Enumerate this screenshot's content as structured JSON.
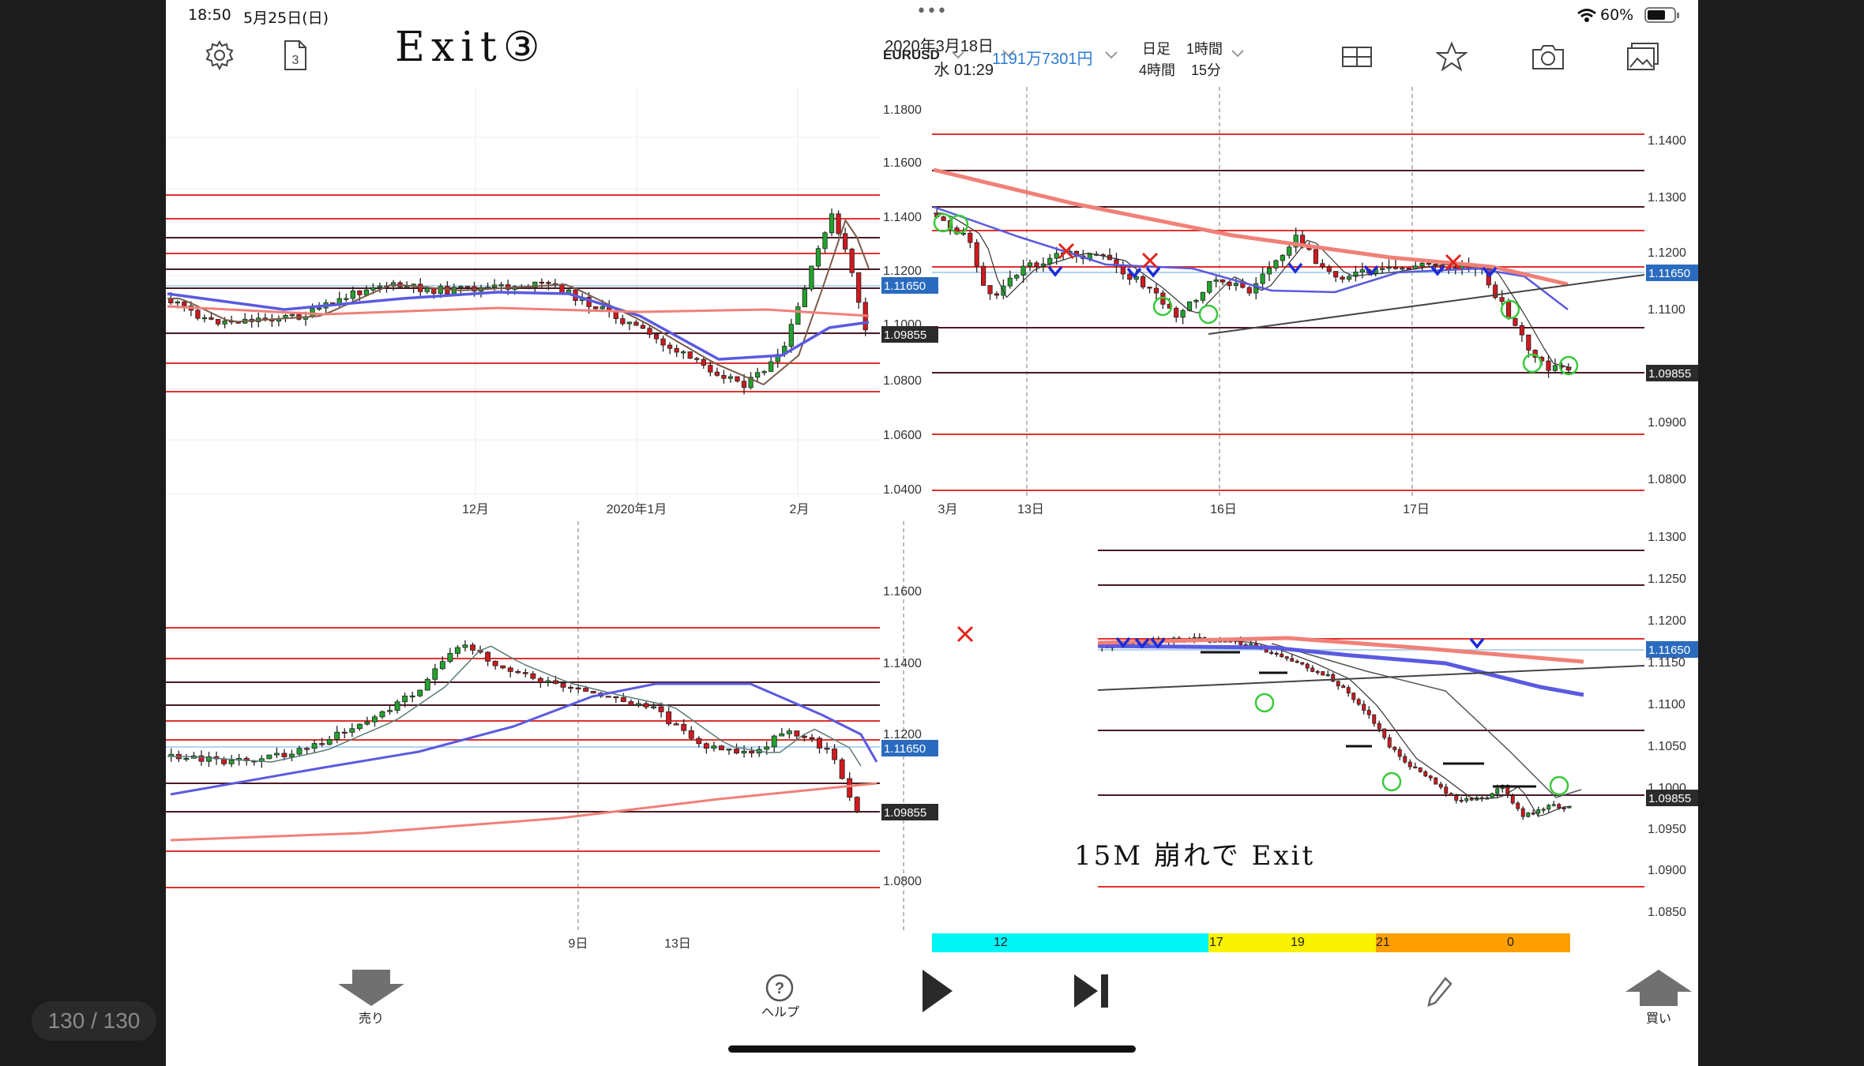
{
  "status_bar": {
    "time": "18:50",
    "date": "5月25日(日)",
    "dots": "•••",
    "battery": "60%"
  },
  "header": {
    "annotation_title": "Exit③",
    "date_line1": "2020年3月18日",
    "date_line2": "水 01:29",
    "symbol": "EURUSD",
    "balance": "1191万7301円",
    "timeframes": {
      "tf1": "日足",
      "tf2": "1時間",
      "tf3": "4時間",
      "tf4": "15分"
    },
    "doc_icon_number": "3"
  },
  "page_counter": "130 / 130",
  "charts": {
    "daily": {
      "y_ticks": [
        "1.1800",
        "1.1600",
        "1.1400",
        "1.1200",
        "1.1000",
        "1.0800",
        "1.0600",
        "1.0400"
      ],
      "x_ticks": [
        "12月",
        "2020年1月",
        "2月",
        "3月"
      ],
      "tags": [
        "1.11650",
        "1.09855"
      ]
    },
    "h4": {
      "y_ticks": [
        "1.1600",
        "1.1400",
        "1.1200",
        "1.0800"
      ],
      "x_ticks": [
        "9日",
        "13日"
      ],
      "tags": [
        "1.11650",
        "1.09855"
      ]
    },
    "h1": {
      "y_ticks": [
        "1.1400",
        "1.1300",
        "1.1200",
        "1.1100",
        "1.0900",
        "1.0800"
      ],
      "x_ticks": [
        "13日",
        "16日",
        "17日"
      ],
      "tags": [
        "1.11650",
        "1.09855"
      ]
    },
    "m15": {
      "y_ticks": [
        "1.1300",
        "1.1250",
        "1.1200",
        "1.1150",
        "1.1100",
        "1.1050",
        "1.1000",
        "1.0950",
        "1.0900",
        "1.0850"
      ],
      "tags": [
        "1.11650",
        "1.09855"
      ],
      "annotation": "15M 崩れで Exit"
    }
  },
  "session_bar": {
    "s1": "12",
    "s2": "17",
    "s3": "19",
    "s4": "21",
    "s5": "0",
    "colors": {
      "cyan": "#00f5f5",
      "yellow": "#f9f200",
      "orange": "#ff9f00"
    }
  },
  "toolbar": {
    "sell_label": "売り",
    "help_label": "ヘルプ",
    "buy_label": "買い"
  },
  "colors": {
    "red_line": "#e0322c",
    "dark_line": "#4a1a22",
    "ma_blue": "#5a5ae0",
    "ma_salmon": "#f08078",
    "tag_blue": "#2a6bbf",
    "tag_dark": "#2b2b2b"
  }
}
